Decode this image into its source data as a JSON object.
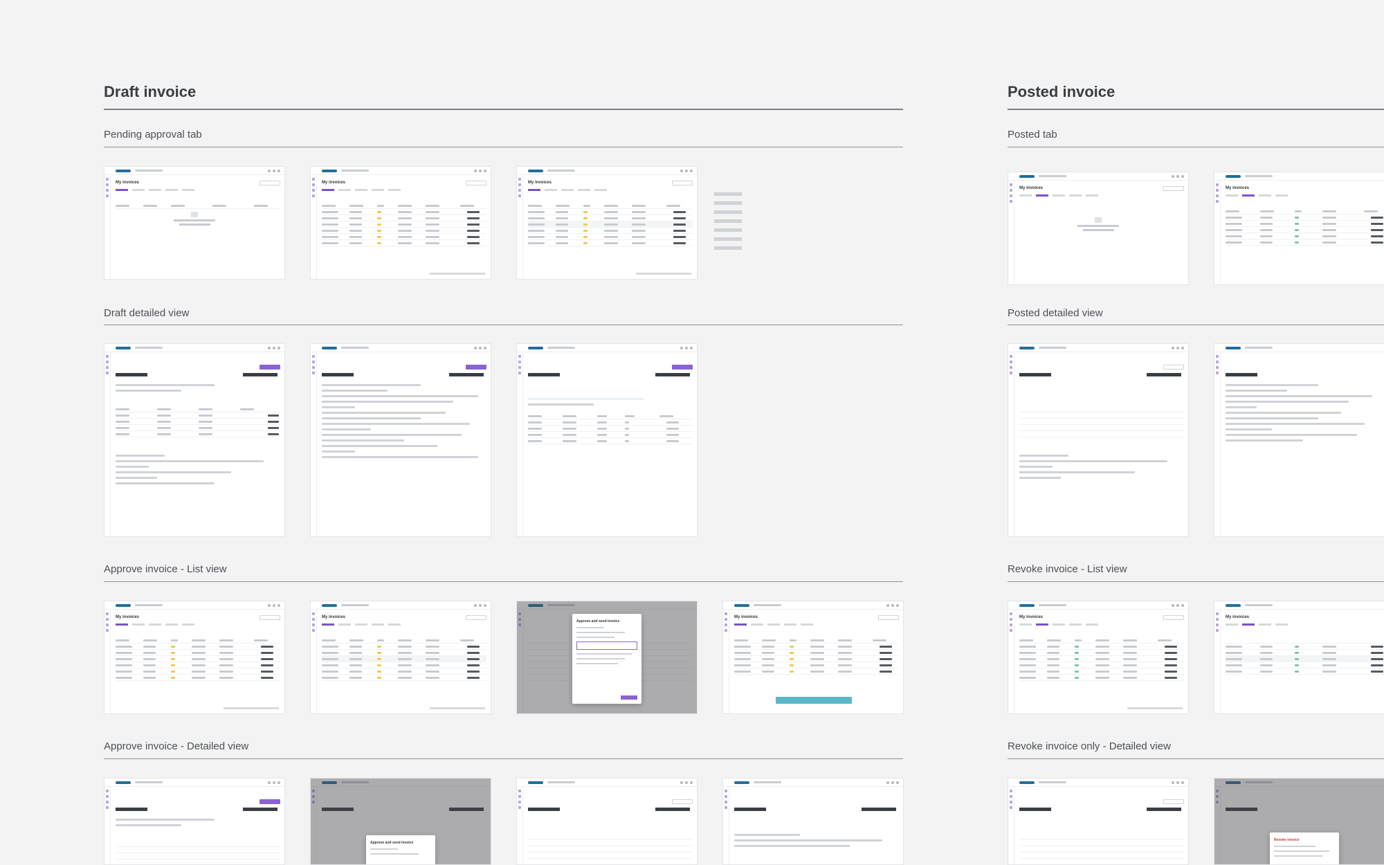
{
  "sections": {
    "draft": {
      "title": "Draft invoice",
      "rows": [
        "Pending approval tab",
        "Draft detailed view",
        "Approve invoice - List view",
        "Approve invoice - Detailed view"
      ]
    },
    "posted": {
      "title": "Posted invoice",
      "rows": [
        "Posted tab",
        "Posted detailed view",
        "Revoke invoice - List view",
        "Revoke invoice only - Detailed view"
      ]
    }
  },
  "mockup": {
    "page_title": "My invoices",
    "modal_title": "Approve and send invoice",
    "revoke_modal_title": "Revoke invoice"
  },
  "colors": {
    "background": "#f3f3f4",
    "accent": "#8a63d2",
    "toast": "#5ab8c6",
    "draft_badge": "#f2c94c",
    "posted_badge": "#7cc7a5"
  }
}
